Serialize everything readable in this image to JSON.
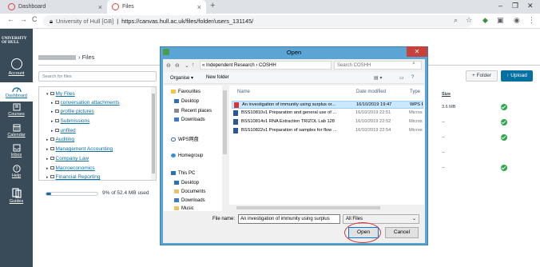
{
  "browser": {
    "tabs": [
      {
        "title": "Dashboard",
        "active": false
      },
      {
        "title": "Files",
        "active": true
      }
    ],
    "url_host": "University of Hull [GB]",
    "url": "https://canvas.hull.ac.uk/files/folder/users_131145/"
  },
  "logo": {
    "line1": "UNIVERSITY",
    "line2": "OF HULL"
  },
  "leftnav": [
    {
      "label": "Account",
      "icon": "user-circle-icon"
    },
    {
      "label": "Dashboard",
      "icon": "dashboard-icon",
      "active": true
    },
    {
      "label": "Courses",
      "icon": "book-icon"
    },
    {
      "label": "Calendar",
      "icon": "calendar-icon"
    },
    {
      "label": "Inbox",
      "icon": "inbox-icon"
    },
    {
      "label": "Help",
      "icon": "help-icon"
    },
    {
      "label": "Guides",
      "icon": "guides-icon"
    }
  ],
  "files_page": {
    "crumb": "Files",
    "search_placeholder": "Search for files",
    "tree": [
      {
        "label": "My Files",
        "level": 0,
        "toggle": "▾"
      },
      {
        "label": "conversation attachments",
        "level": 1,
        "toggle": "▸"
      },
      {
        "label": "profile pictures",
        "level": 1,
        "toggle": "▸"
      },
      {
        "label": "Submissions",
        "level": 1,
        "toggle": "▸"
      },
      {
        "label": "unfiled",
        "level": 1,
        "toggle": "▸"
      },
      {
        "label": "Auditing",
        "level": 0,
        "toggle": "▸"
      },
      {
        "label": "Management Accounting",
        "level": 0,
        "toggle": "▸"
      },
      {
        "label": "Company Law",
        "level": 0,
        "toggle": "▸"
      },
      {
        "label": "Macroeconomics",
        "level": 0,
        "toggle": "▸"
      },
      {
        "label": "Financial Reporting",
        "level": 0,
        "toggle": "▸"
      }
    ],
    "quota_text": "9% of 52.4 MB used",
    "quota_fraction": 0.09,
    "add_folder": "+ Folder",
    "upload": "↑ Upload",
    "size_header": "Size",
    "rows": [
      {
        "size": "3.6 MB",
        "published": true
      },
      {
        "size": "--",
        "published": true
      },
      {
        "size": "--",
        "published": true
      },
      {
        "size": "--",
        "published": false
      },
      {
        "size": "--",
        "published": true
      }
    ]
  },
  "dialog": {
    "title": "Open",
    "path": "« Independent Research ›  COSHH",
    "search_placeholder": "Search COSHH",
    "organise": "Organise ▾",
    "new_folder": "New folder",
    "nav_items": [
      {
        "label": "Favourites",
        "icon": "star-icon"
      },
      {
        "label": "Desktop",
        "icon": "desktop-icon"
      },
      {
        "label": "Recent places",
        "icon": "recent-icon"
      },
      {
        "label": "Downloads",
        "icon": "downloads-icon"
      },
      {
        "label": "WPS网盘",
        "icon": "cloud-icon"
      },
      {
        "label": "Homegroup",
        "icon": "homegroup-icon"
      },
      {
        "label": "This PC",
        "icon": "pc-icon"
      },
      {
        "label": "Desktop",
        "icon": "desktop-icon"
      },
      {
        "label": "Documents",
        "icon": "documents-icon"
      },
      {
        "label": "Downloads",
        "icon": "downloads-icon"
      },
      {
        "label": "Music",
        "icon": "music-icon"
      }
    ],
    "columns": {
      "name": "Name",
      "date": "Date modified",
      "type": "Type"
    },
    "files": [
      {
        "name": "An investigation of immunity using surplus or...",
        "date": "16/10/2019 19:47",
        "type": "WPS P",
        "kind": "pdf",
        "selected": true
      },
      {
        "name": "BSS10810v1  Preparation and general use of ...",
        "date": "16/10/2019 22:51",
        "type": "Micros",
        "kind": "doc",
        "selected": false
      },
      {
        "name": "BSS10814v1  RNA Extraction TRIZOL Lab 128",
        "date": "16/10/2019 22:52",
        "type": "Micros",
        "kind": "doc",
        "selected": false
      },
      {
        "name": "BSS10822v1  Preparation of samples for flow ...",
        "date": "16/10/2019 22:54",
        "type": "Micros",
        "kind": "doc",
        "selected": false
      }
    ],
    "filename_label": "File name:",
    "filename_value": "An investigation of immunity using surplus",
    "filetype": "All Files",
    "open": "Open",
    "cancel": "Cancel"
  }
}
